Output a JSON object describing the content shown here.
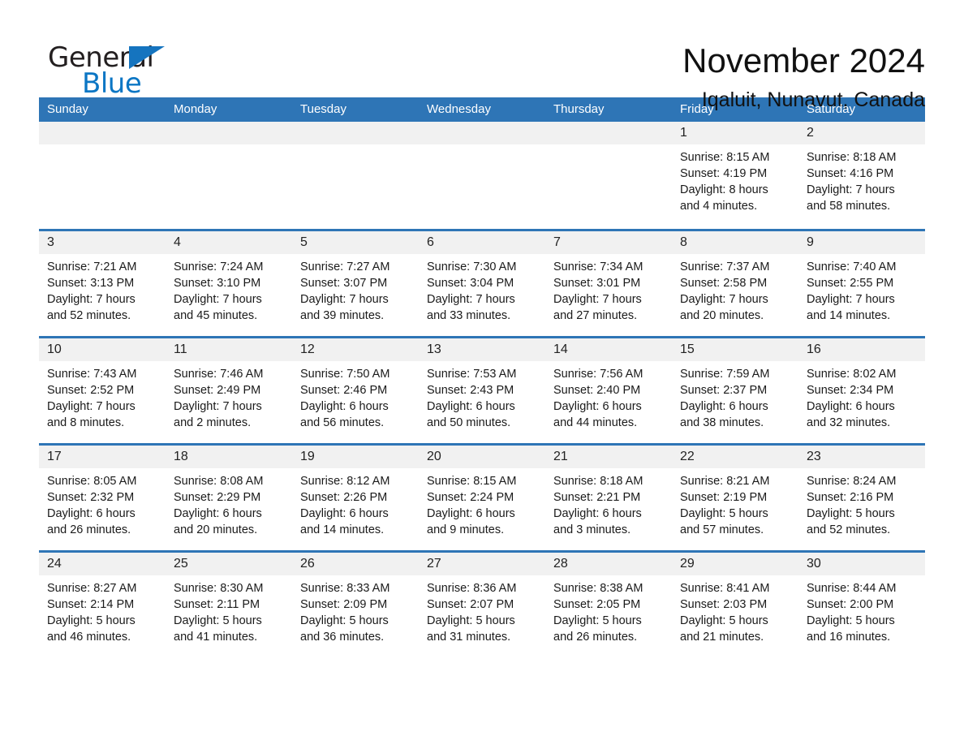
{
  "brand": {
    "name_dark": "General",
    "name_light": "Blue",
    "triangle_color": "#1574bf",
    "blue_text_color": "#0b76c4"
  },
  "header": {
    "month_title": "November 2024",
    "location": "Iqaluit, Nunavut, Canada"
  },
  "theme": {
    "header_blue": "#2e75b6",
    "day_band_gray": "#f1f1f1",
    "page_background": "#ffffff"
  },
  "calendar": {
    "day_headers": [
      "Sunday",
      "Monday",
      "Tuesday",
      "Wednesday",
      "Thursday",
      "Friday",
      "Saturday"
    ],
    "weeks": [
      [
        {
          "day": "",
          "sunrise": "",
          "sunset": "",
          "daylight_line1": "",
          "daylight_line2": ""
        },
        {
          "day": "",
          "sunrise": "",
          "sunset": "",
          "daylight_line1": "",
          "daylight_line2": ""
        },
        {
          "day": "",
          "sunrise": "",
          "sunset": "",
          "daylight_line1": "",
          "daylight_line2": ""
        },
        {
          "day": "",
          "sunrise": "",
          "sunset": "",
          "daylight_line1": "",
          "daylight_line2": ""
        },
        {
          "day": "",
          "sunrise": "",
          "sunset": "",
          "daylight_line1": "",
          "daylight_line2": ""
        },
        {
          "day": "1",
          "sunrise": "Sunrise: 8:15 AM",
          "sunset": "Sunset: 4:19 PM",
          "daylight_line1": "Daylight: 8 hours",
          "daylight_line2": "and 4 minutes."
        },
        {
          "day": "2",
          "sunrise": "Sunrise: 8:18 AM",
          "sunset": "Sunset: 4:16 PM",
          "daylight_line1": "Daylight: 7 hours",
          "daylight_line2": "and 58 minutes."
        }
      ],
      [
        {
          "day": "3",
          "sunrise": "Sunrise: 7:21 AM",
          "sunset": "Sunset: 3:13 PM",
          "daylight_line1": "Daylight: 7 hours",
          "daylight_line2": "and 52 minutes."
        },
        {
          "day": "4",
          "sunrise": "Sunrise: 7:24 AM",
          "sunset": "Sunset: 3:10 PM",
          "daylight_line1": "Daylight: 7 hours",
          "daylight_line2": "and 45 minutes."
        },
        {
          "day": "5",
          "sunrise": "Sunrise: 7:27 AM",
          "sunset": "Sunset: 3:07 PM",
          "daylight_line1": "Daylight: 7 hours",
          "daylight_line2": "and 39 minutes."
        },
        {
          "day": "6",
          "sunrise": "Sunrise: 7:30 AM",
          "sunset": "Sunset: 3:04 PM",
          "daylight_line1": "Daylight: 7 hours",
          "daylight_line2": "and 33 minutes."
        },
        {
          "day": "7",
          "sunrise": "Sunrise: 7:34 AM",
          "sunset": "Sunset: 3:01 PM",
          "daylight_line1": "Daylight: 7 hours",
          "daylight_line2": "and 27 minutes."
        },
        {
          "day": "8",
          "sunrise": "Sunrise: 7:37 AM",
          "sunset": "Sunset: 2:58 PM",
          "daylight_line1": "Daylight: 7 hours",
          "daylight_line2": "and 20 minutes."
        },
        {
          "day": "9",
          "sunrise": "Sunrise: 7:40 AM",
          "sunset": "Sunset: 2:55 PM",
          "daylight_line1": "Daylight: 7 hours",
          "daylight_line2": "and 14 minutes."
        }
      ],
      [
        {
          "day": "10",
          "sunrise": "Sunrise: 7:43 AM",
          "sunset": "Sunset: 2:52 PM",
          "daylight_line1": "Daylight: 7 hours",
          "daylight_line2": "and 8 minutes."
        },
        {
          "day": "11",
          "sunrise": "Sunrise: 7:46 AM",
          "sunset": "Sunset: 2:49 PM",
          "daylight_line1": "Daylight: 7 hours",
          "daylight_line2": "and 2 minutes."
        },
        {
          "day": "12",
          "sunrise": "Sunrise: 7:50 AM",
          "sunset": "Sunset: 2:46 PM",
          "daylight_line1": "Daylight: 6 hours",
          "daylight_line2": "and 56 minutes."
        },
        {
          "day": "13",
          "sunrise": "Sunrise: 7:53 AM",
          "sunset": "Sunset: 2:43 PM",
          "daylight_line1": "Daylight: 6 hours",
          "daylight_line2": "and 50 minutes."
        },
        {
          "day": "14",
          "sunrise": "Sunrise: 7:56 AM",
          "sunset": "Sunset: 2:40 PM",
          "daylight_line1": "Daylight: 6 hours",
          "daylight_line2": "and 44 minutes."
        },
        {
          "day": "15",
          "sunrise": "Sunrise: 7:59 AM",
          "sunset": "Sunset: 2:37 PM",
          "daylight_line1": "Daylight: 6 hours",
          "daylight_line2": "and 38 minutes."
        },
        {
          "day": "16",
          "sunrise": "Sunrise: 8:02 AM",
          "sunset": "Sunset: 2:34 PM",
          "daylight_line1": "Daylight: 6 hours",
          "daylight_line2": "and 32 minutes."
        }
      ],
      [
        {
          "day": "17",
          "sunrise": "Sunrise: 8:05 AM",
          "sunset": "Sunset: 2:32 PM",
          "daylight_line1": "Daylight: 6 hours",
          "daylight_line2": "and 26 minutes."
        },
        {
          "day": "18",
          "sunrise": "Sunrise: 8:08 AM",
          "sunset": "Sunset: 2:29 PM",
          "daylight_line1": "Daylight: 6 hours",
          "daylight_line2": "and 20 minutes."
        },
        {
          "day": "19",
          "sunrise": "Sunrise: 8:12 AM",
          "sunset": "Sunset: 2:26 PM",
          "daylight_line1": "Daylight: 6 hours",
          "daylight_line2": "and 14 minutes."
        },
        {
          "day": "20",
          "sunrise": "Sunrise: 8:15 AM",
          "sunset": "Sunset: 2:24 PM",
          "daylight_line1": "Daylight: 6 hours",
          "daylight_line2": "and 9 minutes."
        },
        {
          "day": "21",
          "sunrise": "Sunrise: 8:18 AM",
          "sunset": "Sunset: 2:21 PM",
          "daylight_line1": "Daylight: 6 hours",
          "daylight_line2": "and 3 minutes."
        },
        {
          "day": "22",
          "sunrise": "Sunrise: 8:21 AM",
          "sunset": "Sunset: 2:19 PM",
          "daylight_line1": "Daylight: 5 hours",
          "daylight_line2": "and 57 minutes."
        },
        {
          "day": "23",
          "sunrise": "Sunrise: 8:24 AM",
          "sunset": "Sunset: 2:16 PM",
          "daylight_line1": "Daylight: 5 hours",
          "daylight_line2": "and 52 minutes."
        }
      ],
      [
        {
          "day": "24",
          "sunrise": "Sunrise: 8:27 AM",
          "sunset": "Sunset: 2:14 PM",
          "daylight_line1": "Daylight: 5 hours",
          "daylight_line2": "and 46 minutes."
        },
        {
          "day": "25",
          "sunrise": "Sunrise: 8:30 AM",
          "sunset": "Sunset: 2:11 PM",
          "daylight_line1": "Daylight: 5 hours",
          "daylight_line2": "and 41 minutes."
        },
        {
          "day": "26",
          "sunrise": "Sunrise: 8:33 AM",
          "sunset": "Sunset: 2:09 PM",
          "daylight_line1": "Daylight: 5 hours",
          "daylight_line2": "and 36 minutes."
        },
        {
          "day": "27",
          "sunrise": "Sunrise: 8:36 AM",
          "sunset": "Sunset: 2:07 PM",
          "daylight_line1": "Daylight: 5 hours",
          "daylight_line2": "and 31 minutes."
        },
        {
          "day": "28",
          "sunrise": "Sunrise: 8:38 AM",
          "sunset": "Sunset: 2:05 PM",
          "daylight_line1": "Daylight: 5 hours",
          "daylight_line2": "and 26 minutes."
        },
        {
          "day": "29",
          "sunrise": "Sunrise: 8:41 AM",
          "sunset": "Sunset: 2:03 PM",
          "daylight_line1": "Daylight: 5 hours",
          "daylight_line2": "and 21 minutes."
        },
        {
          "day": "30",
          "sunrise": "Sunrise: 8:44 AM",
          "sunset": "Sunset: 2:00 PM",
          "daylight_line1": "Daylight: 5 hours",
          "daylight_line2": "and 16 minutes."
        }
      ]
    ]
  }
}
